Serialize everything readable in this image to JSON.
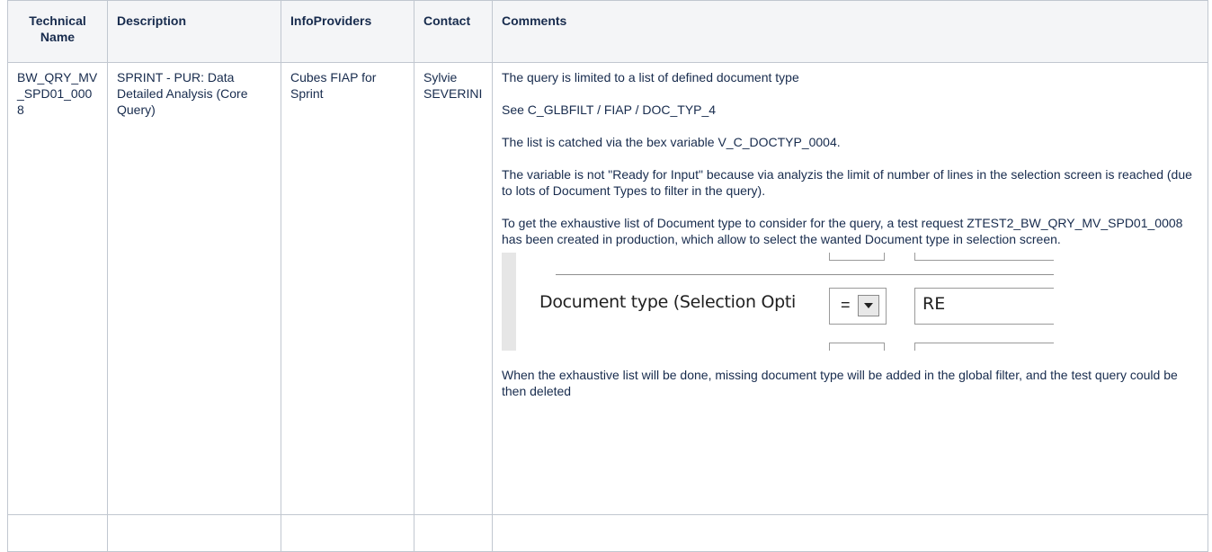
{
  "table": {
    "headers": {
      "technical_name": "Technical Name",
      "description": "Description",
      "infoproviders": "InfoProviders",
      "contact": "Contact",
      "comments": "Comments"
    },
    "row": {
      "technical_name": "BW_QRY_MV_SPD01_0008",
      "description": "SPRINT - PUR: Data Detailed Analysis (Core Query)",
      "infoproviders": "Cubes FIAP for Sprint",
      "contact": "Sylvie SEVERINI",
      "comments": [
        "The query is limited to a list of defined document type",
        "See C_GLBFILT / FIAP / DOC_TYP_4",
        "The list is catched via the bex variable V_C_DOCTYP_0004.",
        "The variable is not \"Ready for Input\" because via analyzis the limit of number of lines in the selection screen is reached (due to lots of Document Types to filter in the query).",
        "To get the exhaustive list of Document type to consider for the query, a test request ZTEST2_BW_QRY_MV_SPD01_0008 has been created in production, which allow to select the wanted Document type in selection screen."
      ],
      "embedded_screenshot": {
        "label": "Document type  (Selection Opti",
        "operator": "=",
        "value": "RE"
      },
      "comments_after": "When the exhaustive list will be done, missing document type will be added in the global filter, and the test query could be then deleted"
    }
  }
}
